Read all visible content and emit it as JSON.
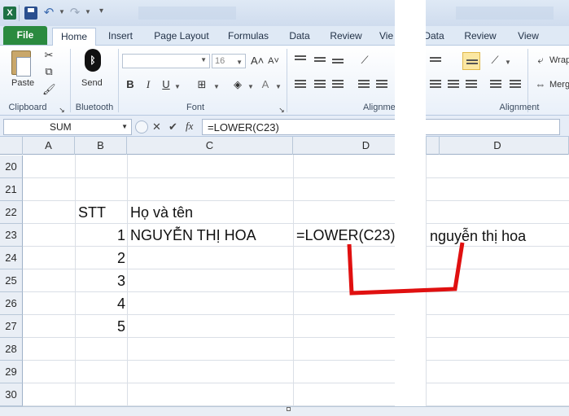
{
  "qat": {
    "logo": "X"
  },
  "tabs": {
    "file": "File",
    "left": [
      "Home",
      "Insert",
      "Page Layout",
      "Formulas",
      "Data",
      "Review",
      "Vie"
    ],
    "right": [
      "Data",
      "Review",
      "View"
    ]
  },
  "ribbon": {
    "clipboard": {
      "paste_label": "Paste",
      "group_label": "Clipboard"
    },
    "bluetooth": {
      "send_label": "Send",
      "group_label": "Bluetooth"
    },
    "font": {
      "font_name": "",
      "font_size": "16",
      "grow": "A˄",
      "shrink": "A˅",
      "bold": "B",
      "italic": "I",
      "underline": "U",
      "font_color": "A",
      "group_label": "Font"
    },
    "alignment_left": {
      "group_label": "Alignme"
    },
    "alignment_right": {
      "wrap_label": "Wrap",
      "merge_label": "Merg",
      "group_label": "Alignment"
    }
  },
  "formula_bar": {
    "name_box": "SUM",
    "cancel": "✕",
    "enter": "✔",
    "fx": "fx",
    "formula": "=LOWER(C23)"
  },
  "columns": {
    "left": [
      "A",
      "B",
      "C",
      "D"
    ],
    "right": [
      "D"
    ]
  },
  "rows": [
    "20",
    "21",
    "22",
    "23",
    "24",
    "25",
    "26",
    "27",
    "28",
    "29",
    "30"
  ],
  "cells": {
    "b22": "STT",
    "c22": "Họ và tên",
    "b23": "1",
    "c23": "NGUYỄN THỊ HOA",
    "d23_left": "=LOWER(C23)",
    "d23_right": "nguyễn thị hoa",
    "b24": "2",
    "b25": "3",
    "b26": "4",
    "b27": "5"
  },
  "annotation": {
    "color": "#e01010"
  }
}
